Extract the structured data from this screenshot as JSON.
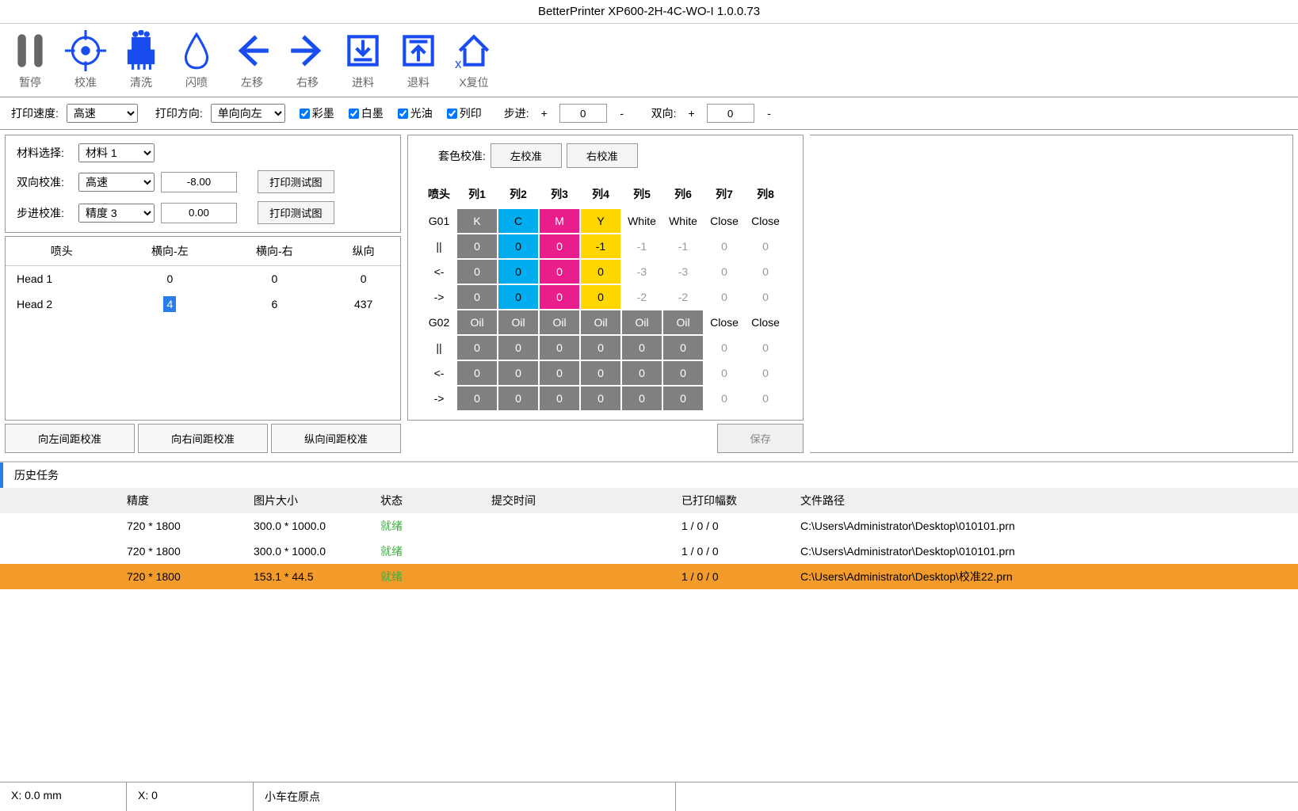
{
  "title": "BetterPrinter XP600-2H-4C-WO-I 1.0.0.73",
  "toolbar": [
    {
      "name": "pause",
      "label": "暂停"
    },
    {
      "name": "calibrate",
      "label": "校准"
    },
    {
      "name": "clean",
      "label": "清洗"
    },
    {
      "name": "flash",
      "label": "闪喷"
    },
    {
      "name": "move-left",
      "label": "左移"
    },
    {
      "name": "move-right",
      "label": "右移"
    },
    {
      "name": "feed",
      "label": "进料"
    },
    {
      "name": "retract",
      "label": "退料"
    },
    {
      "name": "x-reset",
      "label": "X复位"
    }
  ],
  "options": {
    "print_speed_label": "打印速度:",
    "print_speed": "高速",
    "print_dir_label": "打印方向:",
    "print_dir": "单向向左",
    "chk_color": "彩墨",
    "chk_white": "白墨",
    "chk_oil": "光油",
    "chk_print": "列印",
    "step_label": "步进:",
    "step_val": "0",
    "bidir_label": "双向:",
    "bidir_val": "0",
    "plus": "+",
    "minus": "-"
  },
  "settings": {
    "material_label": "材料选择:",
    "material": "材料 1",
    "bidir_cal_label": "双向校准:",
    "bidir_cal_mode": "高速",
    "bidir_cal_val": "-8.00",
    "step_cal_label": "步进校准:",
    "step_cal_mode": "精度 3",
    "step_cal_val": "0.00",
    "test_btn": "打印测试图"
  },
  "head_table": {
    "headers": [
      "喷头",
      "横向-左",
      "横向-右",
      "纵向"
    ],
    "rows": [
      {
        "name": "Head 1",
        "l": "0",
        "r": "0",
        "v": "0"
      },
      {
        "name": "Head 2",
        "l": "4",
        "r": "6",
        "v": "437",
        "selected": true
      }
    ]
  },
  "cal_btns": {
    "left": "向左间距校准",
    "right": "向右间距校准",
    "vert": "纵向间距校准"
  },
  "color_cal": {
    "label": "套色校准:",
    "left_btn": "左校准",
    "right_btn": "右校准",
    "save": "保存",
    "col_headers": [
      "喷头",
      "列1",
      "列2",
      "列3",
      "列4",
      "列5",
      "列6",
      "列7",
      "列8"
    ],
    "groups": [
      {
        "name": "G01",
        "colors": [
          "K",
          "C",
          "M",
          "Y",
          "White",
          "White",
          "Close",
          "Close"
        ],
        "r1": [
          "||",
          "0",
          "0",
          "0",
          "-1",
          "-1",
          "-1",
          "0",
          "0"
        ],
        "r2": [
          "<-",
          "0",
          "0",
          "0",
          "0",
          "-3",
          "-3",
          "0",
          "0"
        ],
        "r3": [
          "->",
          "0",
          "0",
          "0",
          "0",
          "-2",
          "-2",
          "0",
          "0"
        ]
      },
      {
        "name": "G02",
        "colors": [
          "Oil",
          "Oil",
          "Oil",
          "Oil",
          "Oil",
          "Oil",
          "Close",
          "Close"
        ],
        "r1": [
          "||",
          "0",
          "0",
          "0",
          "0",
          "0",
          "0",
          "0",
          "0"
        ],
        "r2": [
          "<-",
          "0",
          "0",
          "0",
          "0",
          "0",
          "0",
          "0",
          "0"
        ],
        "r3": [
          "->",
          "0",
          "0",
          "0",
          "0",
          "0",
          "0",
          "0",
          "0"
        ]
      }
    ]
  },
  "history": {
    "tab": "历史任务",
    "headers": [
      "精度",
      "图片大小",
      "状态",
      "提交时间",
      "已打印幅数",
      "文件路径"
    ],
    "rows": [
      {
        "prec": "720 * 1800",
        "size": "300.0 * 1000.0",
        "status": "就绪",
        "time": "",
        "count": "1 / 0 / 0",
        "path": "C:\\Users\\Administrator\\Desktop\\010101.prn"
      },
      {
        "prec": "720 * 1800",
        "size": "300.0 * 1000.0",
        "status": "就绪",
        "time": "",
        "count": "1 / 0 / 0",
        "path": "C:\\Users\\Administrator\\Desktop\\010101.prn"
      },
      {
        "prec": "720 * 1800",
        "size": "153.1 * 44.5",
        "status": "就绪",
        "time": "",
        "count": "1 / 0 / 0",
        "path": "C:\\Users\\Administrator\\Desktop\\校准22.prn",
        "selected": true
      }
    ]
  },
  "status": {
    "x_mm": "X: 0.0 mm",
    "x": "X: 0",
    "msg": "小车在原点"
  }
}
